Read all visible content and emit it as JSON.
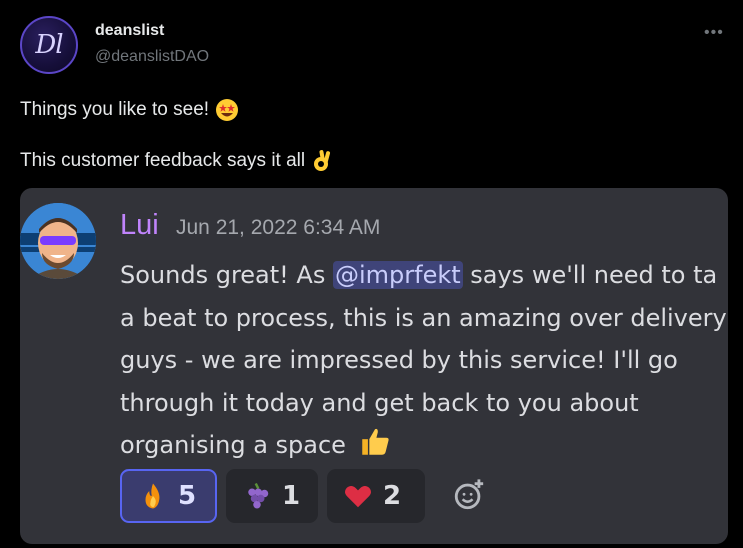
{
  "post": {
    "display_name": "deanslist",
    "handle": "@deanslistDAO",
    "avatar_text": "Dl",
    "more_icon": "more-horizontal-icon",
    "text_line_1": "Things you like to see!",
    "text_line_1_emoji": "star-struck-emoji",
    "text_line_2": "This customer feedback says it all",
    "text_line_2_emoji": "ok-hand-emoji"
  },
  "embed": {
    "author": "Lui",
    "timestamp": "Jun 21, 2022 6:34 AM",
    "body_pre": "Sounds great! As ",
    "mention": "@imprfekt",
    "body_line1_post": " says we'll need to ta",
    "body_line2": "a beat to process, this is an amazing over delivery",
    "body_line3": "guys - we are impressed by this service! I'll go",
    "body_line4": "through it today and get back to you about",
    "body_line5": "organising a space",
    "body_end_emoji": "thumbs-up-emoji",
    "reactions": [
      {
        "emoji": "fire-emoji",
        "count": "5",
        "active": true
      },
      {
        "emoji": "grapes-emoji",
        "count": "1",
        "active": false
      },
      {
        "emoji": "red-heart-emoji",
        "count": "2",
        "active": false
      }
    ],
    "add_reaction_icon": "add-reaction-icon"
  },
  "colors": {
    "background": "#000000",
    "card": "#323339",
    "author": "#c084fc",
    "mention_bg": "#3f4479",
    "active_reaction_border": "#5865f2"
  }
}
